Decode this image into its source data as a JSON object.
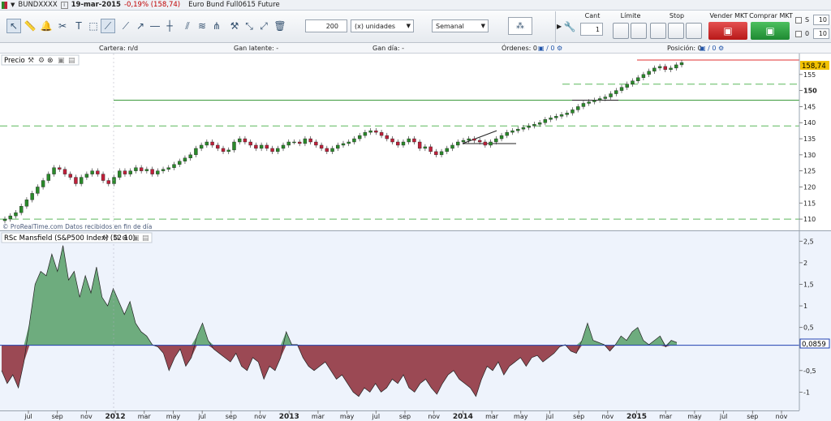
{
  "window": {
    "symbol": "BUNDXXXX",
    "date": "19-mar-2015",
    "change": "-0,19% (158,74)",
    "instrument": "Euro Bund Full0615 Future"
  },
  "toolbar": {
    "quantity": "200",
    "unit_label": "(x) unidades",
    "period": "Semanal"
  },
  "order": {
    "cant_label": "Cant",
    "cant_value": "1",
    "limit_label": "Límite",
    "stop_label": "Stop",
    "sell_label": "Vender MKT",
    "buy_label": "Comprar MKT",
    "s_label": "S",
    "s_value": "10",
    "zero_label": "0",
    "zero_value": "10"
  },
  "infobar": {
    "cartera": "Cartera:  n/d",
    "gan_latente": "Gan latente:  -",
    "gan_dia": "Gan día:  -",
    "ordenes": "Órdenes:  0",
    "posicion": "Posición:  0"
  },
  "price_panel": {
    "title": "Precio",
    "last_price": "158,74",
    "watermark": "© ProRealTime.com  Datos recibidos en fin de día"
  },
  "rsc_panel": {
    "title": "RSc Mansfield (S&P500 Index) (52 10)",
    "last_value": "0,0859"
  },
  "colors": {
    "up": "#2a8a2a",
    "down": "#c0203a",
    "hline_solid": "#3c9a3c",
    "hline_dashed": "#5cb85c",
    "price_tag": "#f2c200",
    "stop_line": "#e03030",
    "rsc_line": "#1f3fb0",
    "pos_fill": "#4d9a5e",
    "neg_fill": "#8c2a36"
  },
  "chart_data": [
    {
      "type": "candlestick",
      "title": "Precio",
      "x_labels": [
        "jul",
        "sep",
        "nov",
        "2012",
        "mar",
        "may",
        "jul",
        "sep",
        "nov",
        "2013",
        "mar",
        "may",
        "jul",
        "sep",
        "nov",
        "2014",
        "mar",
        "may",
        "jul",
        "sep",
        "nov",
        "2015",
        "mar",
        "may",
        "jul",
        "sep",
        "nov"
      ],
      "ylim": [
        108,
        160
      ],
      "y_ticks": [
        110,
        115,
        120,
        125,
        130,
        135,
        140,
        145,
        150,
        155
      ],
      "grid": false,
      "horizontal_levels": [
        {
          "value": 110,
          "style": "dashed"
        },
        {
          "value": 139,
          "style": "dashed"
        },
        {
          "value": 147,
          "style": "solid"
        },
        {
          "value": 152,
          "style": "dashed"
        },
        {
          "value": 159.5,
          "style": "solid"
        }
      ],
      "series": [
        {
          "values": [
            110,
            111,
            112,
            114,
            116,
            118,
            120,
            122,
            124,
            126,
            125.5,
            124,
            123,
            121,
            123,
            124,
            125,
            124,
            122,
            121,
            123,
            125,
            124,
            125,
            126,
            125,
            125.5,
            124,
            125,
            125.5,
            126,
            127,
            128,
            129,
            130,
            132,
            133,
            134,
            133,
            132,
            131,
            131.5,
            134,
            135,
            134,
            133,
            132,
            133,
            132,
            131,
            132,
            133,
            134,
            134,
            133.5,
            135,
            134,
            133,
            132,
            131,
            132,
            133,
            133.5,
            134,
            135,
            136,
            137,
            137.5,
            137,
            136,
            135,
            134,
            133,
            134,
            135,
            134,
            132,
            132.5,
            131,
            130,
            131,
            132,
            133,
            134,
            134.5,
            135,
            134.5,
            134,
            133,
            134,
            135,
            136,
            137,
            137.5,
            138,
            138.5,
            139,
            139.5,
            140,
            141,
            141.5,
            142,
            142.5,
            143,
            144,
            145,
            146,
            146.5,
            147,
            147.5,
            148,
            149,
            150,
            151,
            152,
            153,
            154,
            155,
            156,
            157,
            157.5,
            156.5,
            157,
            158,
            158.7
          ]
        }
      ]
    },
    {
      "type": "area",
      "title": "RSc Mansfield (S&P500 Index) (52 10)",
      "x_labels": [
        "jul",
        "sep",
        "nov",
        "2012",
        "mar",
        "may",
        "jul",
        "sep",
        "nov",
        "2013",
        "mar",
        "may",
        "jul",
        "sep",
        "nov",
        "2014",
        "mar",
        "may",
        "jul",
        "sep",
        "nov",
        "2015",
        "mar",
        "may",
        "jul",
        "sep",
        "nov"
      ],
      "ylim": [
        -1.35,
        2.6
      ],
      "y_ticks": [
        2.5,
        2,
        1.5,
        1,
        0.5,
        0.0859,
        -0.5,
        -1
      ],
      "baseline": 0.0859,
      "series": [
        {
          "values": [
            -0.5,
            -0.8,
            -0.6,
            -0.9,
            -0.3,
            0.6,
            1.5,
            1.8,
            1.7,
            2.2,
            1.8,
            2.4,
            1.6,
            1.8,
            1.2,
            1.7,
            1.3,
            1.9,
            1.2,
            1.0,
            1.4,
            1.1,
            0.8,
            1.1,
            0.6,
            0.4,
            0.3,
            0.1,
            0.05,
            -0.1,
            -0.5,
            -0.2,
            0,
            -0.4,
            -0.2,
            0.3,
            0.6,
            0.2,
            0,
            -0.1,
            -0.2,
            -0.3,
            -0.1,
            -0.4,
            -0.5,
            -0.2,
            -0.3,
            -0.7,
            -0.4,
            -0.5,
            -0.2,
            0.4,
            0.1,
            0.1,
            -0.2,
            -0.4,
            -0.5,
            -0.4,
            -0.3,
            -0.5,
            -0.7,
            -0.6,
            -0.8,
            -1.0,
            -1.1,
            -0.9,
            -1.0,
            -0.8,
            -1.0,
            -0.9,
            -0.7,
            -0.8,
            -0.6,
            -0.9,
            -1.0,
            -0.8,
            -0.7,
            -0.9,
            -1.05,
            -0.8,
            -0.6,
            -0.5,
            -0.7,
            -0.8,
            -0.9,
            -1.1,
            -0.7,
            -0.4,
            -0.5,
            -0.3,
            -0.6,
            -0.4,
            -0.3,
            -0.2,
            -0.4,
            -0.2,
            -0.15,
            -0.3,
            -0.2,
            -0.1,
            0.05,
            0.1,
            -0.05,
            -0.1,
            0.2,
            0.6,
            0.2,
            0.15,
            0.1,
            -0.05,
            0.1,
            0.3,
            0.2,
            0.4,
            0.5,
            0.2,
            0.1,
            0.2,
            0.3,
            0.05,
            0.2,
            0.15
          ]
        }
      ]
    }
  ]
}
